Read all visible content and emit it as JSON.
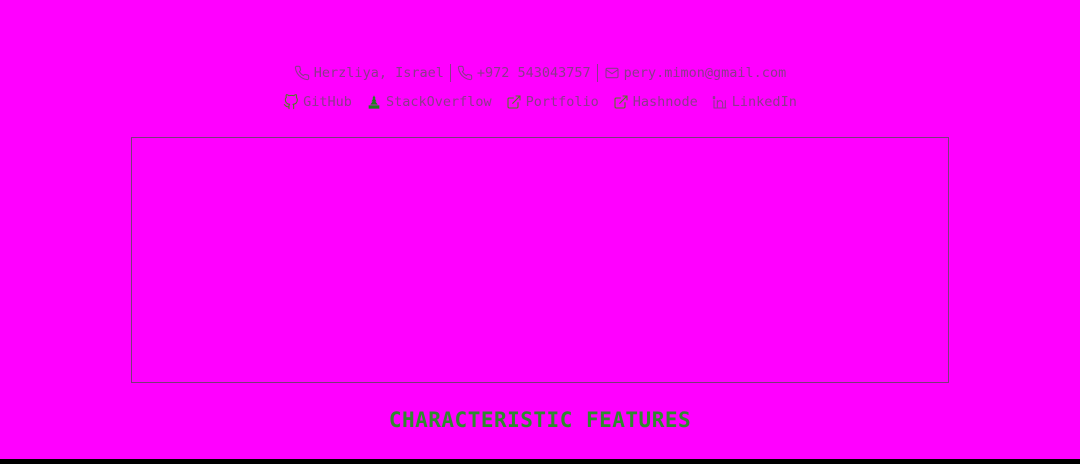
{
  "contact": {
    "location": "Herzliya, Israel",
    "phone": "+972 543043757",
    "email": "pery.mimon@gmail.com"
  },
  "links": [
    {
      "label": "GitHub",
      "icon": "github-icon"
    },
    {
      "label": "StackOverflow",
      "icon": "stackoverflow-icon"
    },
    {
      "label": "Portfolio",
      "icon": "external-link-icon"
    },
    {
      "label": "Hashnode",
      "icon": "external-link-icon"
    },
    {
      "label": "LinkedIn",
      "icon": "linkedin-icon"
    }
  ],
  "section": {
    "title": "CHARACTERISTIC FEATURES"
  },
  "colors": {
    "background": "#ff00ff",
    "text": "#8a3a8a",
    "heading": "#2f8a2f",
    "link_icon": "#4d7f1f"
  }
}
